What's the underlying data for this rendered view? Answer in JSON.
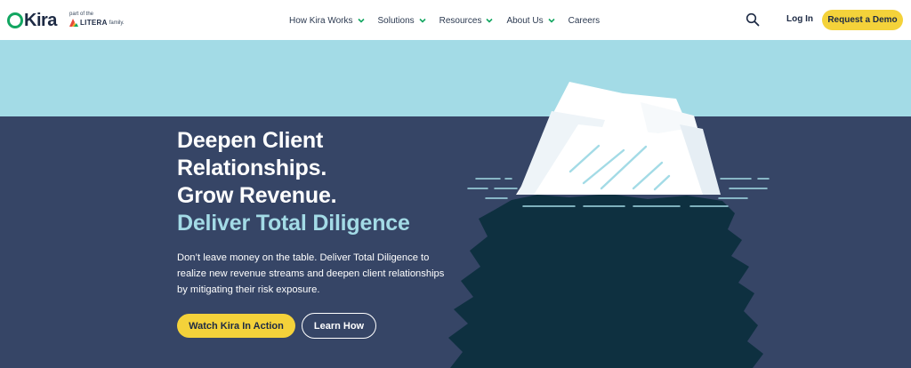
{
  "brand": {
    "logo_word": "Kira",
    "partner_prefix": "part of the",
    "partner_name": "LITERA",
    "partner_suffix": "family."
  },
  "nav": {
    "items": [
      {
        "label": "How Kira Works",
        "has_dropdown": true
      },
      {
        "label": "Solutions",
        "has_dropdown": true
      },
      {
        "label": "Resources",
        "has_dropdown": true
      },
      {
        "label": "About Us",
        "has_dropdown": true
      },
      {
        "label": "Careers",
        "has_dropdown": false
      }
    ],
    "login_label": "Log In",
    "demo_label": "Request a Demo"
  },
  "hero": {
    "headline_lines": [
      "Deepen Client",
      "Relationships.",
      "Grow Revenue."
    ],
    "accent_line": "Deliver Total Diligence",
    "lead": "Don’t leave money on the table. Deliver Total Diligence to realize new revenue streams and deepen client relationships by mitigating their risk exposure.",
    "primary_cta": "Watch Kira In Action",
    "secondary_cta": "Learn How"
  },
  "colors": {
    "brand_green": "#12a661",
    "accent_yellow": "#f4d23a",
    "sky": "#a3dbe6",
    "sea": "#364566",
    "iceberg_deep": "#0e3040",
    "navy_text": "#1d2a44"
  },
  "icons": {
    "search": "search-icon",
    "chevron": "chevron-down-icon",
    "iceberg": "iceberg-illustration"
  }
}
